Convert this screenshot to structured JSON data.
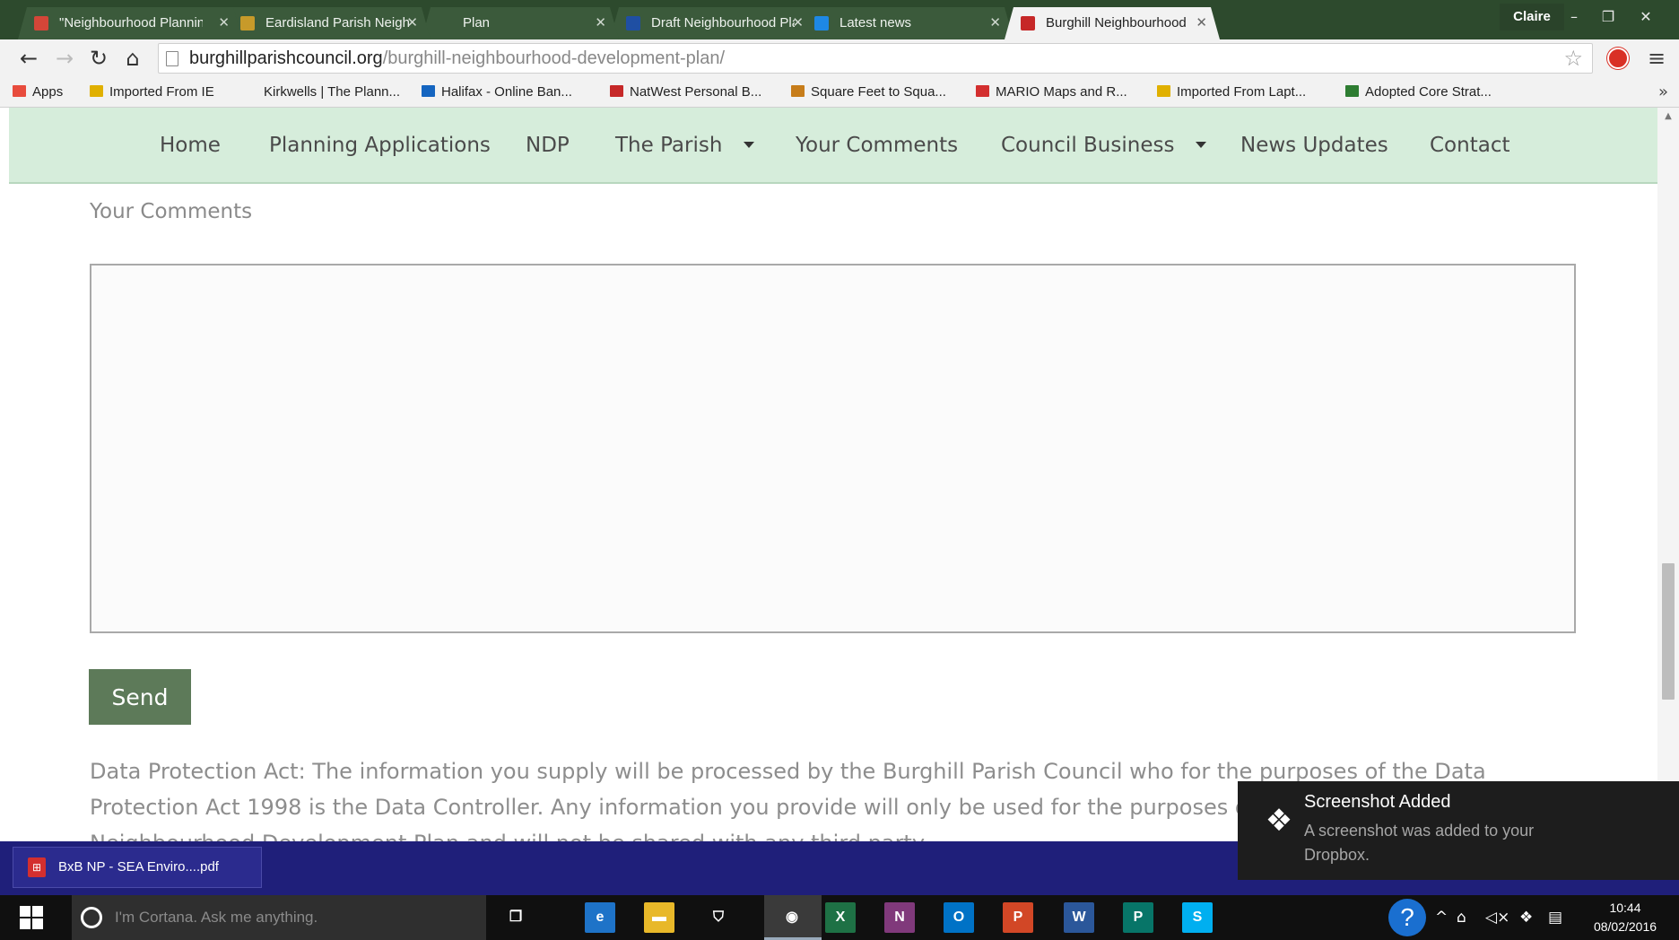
{
  "browser": {
    "tabs": [
      {
        "title": "\"Neighbourhood Plannin",
        "favicon": "mail-icon",
        "favicon_color": "#d44638",
        "active": false
      },
      {
        "title": "Eardisland Parish Neighb",
        "favicon": "crest-icon",
        "favicon_color": "#c79a2a",
        "active": false
      },
      {
        "title": "Plan",
        "favicon": "none",
        "favicon_color": "#3b5a3b",
        "active": false
      },
      {
        "title": "Draft Neighbourhood Pla",
        "favicon": "shield-icon",
        "favicon_color": "#1f4fa3",
        "active": false
      },
      {
        "title": "Latest news",
        "favicon": "flag-icon",
        "favicon_color": "#1e88e5",
        "active": false
      },
      {
        "title": "Burghill Neighbourhood D",
        "favicon": "calendar-icon",
        "favicon_color": "#c62828",
        "active": true
      }
    ],
    "profile_name": "Claire",
    "url_host": "burghillparishcouncil.org",
    "url_path": "/burghill-neighbourhood-development-plan/",
    "bookmarks": [
      {
        "label": "Apps",
        "icon": "apps-icon",
        "color": "#e84c3d"
      },
      {
        "label": "Imported From IE",
        "icon": "folder-icon",
        "color": "#e0b000"
      },
      {
        "label": "Kirkwells | The Plann...",
        "icon": "page-icon",
        "color": "#f2f2f2"
      },
      {
        "label": "Halifax - Online Ban...",
        "icon": "bank-icon",
        "color": "#1565c0"
      },
      {
        "label": "NatWest Personal B...",
        "icon": "natwest-icon",
        "color": "#c62828"
      },
      {
        "label": "Square Feet to Squa...",
        "icon": "grid-icon",
        "color": "#c77d1a"
      },
      {
        "label": "MARIO Maps and R...",
        "icon": "map-icon",
        "color": "#d32f2f"
      },
      {
        "label": "Imported From Lapt...",
        "icon": "folder-icon",
        "color": "#e0b000"
      },
      {
        "label": "Adopted Core Strat...",
        "icon": "doc-icon",
        "color": "#2e7d32"
      }
    ],
    "bookmarks_more": "»"
  },
  "site": {
    "nav": [
      {
        "label": "Home",
        "dropdown": false
      },
      {
        "label": "Planning Applications",
        "dropdown": false
      },
      {
        "label": "NDP",
        "dropdown": false
      },
      {
        "label": "The Parish",
        "dropdown": true
      },
      {
        "label": "Your Comments",
        "dropdown": false
      },
      {
        "label": "Council Business",
        "dropdown": true
      },
      {
        "label": "News Updates",
        "dropdown": false
      },
      {
        "label": "Contact",
        "dropdown": false
      }
    ],
    "comments_label": "Your Comments",
    "comments_value": "",
    "send_label": "Send",
    "data_protection_text": "Data Protection Act: The information you supply will be processed by the Burghill Parish Council who for the purposes of the Data Protection Act 1998 is the Data Controller. Any information you provide will only be used for the purposes of informing Burghill Neighbourhood Development Plan and will not be shared with any third party."
  },
  "download": {
    "filename": "BxB NP - SEA Enviro....pdf"
  },
  "toast": {
    "title": "Screenshot Added",
    "body": "A screenshot was added to your Dropbox."
  },
  "taskbar": {
    "cortana_placeholder": "I'm Cortana. Ask me anything.",
    "apps": [
      {
        "name": "task-view-icon",
        "glyph": "❐",
        "color": "#101010"
      },
      {
        "name": "edge-icon",
        "glyph": "e",
        "color": "#1e73c8"
      },
      {
        "name": "file-explorer-icon",
        "glyph": "▬",
        "color": "#e8b829"
      },
      {
        "name": "store-icon",
        "glyph": "⛉",
        "color": "#101010"
      },
      {
        "name": "chrome-icon",
        "glyph": "◉",
        "color": "#3a3a3a"
      },
      {
        "name": "excel-icon",
        "glyph": "X",
        "color": "#1e7145"
      },
      {
        "name": "onenote-icon",
        "glyph": "N",
        "color": "#80397b"
      },
      {
        "name": "outlook-icon",
        "glyph": "O",
        "color": "#0072c6"
      },
      {
        "name": "powerpoint-icon",
        "glyph": "P",
        "color": "#d24726"
      },
      {
        "name": "word-icon",
        "glyph": "W",
        "color": "#2b579a"
      },
      {
        "name": "publisher-icon",
        "glyph": "P",
        "color": "#077568"
      },
      {
        "name": "skype-icon",
        "glyph": "S",
        "color": "#00aff0"
      }
    ],
    "time": "10:44",
    "date": "08/02/2016"
  }
}
